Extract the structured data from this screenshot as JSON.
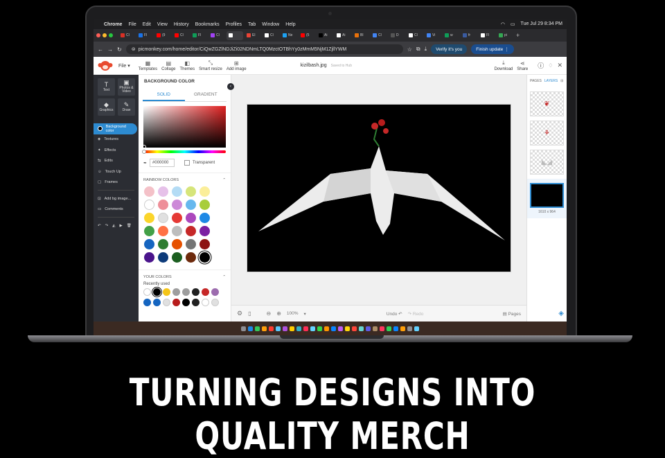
{
  "headline": "TURNING DESIGNS INTO QUALITY MERCH",
  "menubar": {
    "apple": "",
    "app": "Chrome",
    "items": [
      "File",
      "Edit",
      "View",
      "History",
      "Bookmarks",
      "Profiles",
      "Tab",
      "Window",
      "Help"
    ],
    "clock": "Tue Jul 29  8:34 PM"
  },
  "tabs": [
    "Cl",
    "Fl",
    "(9",
    "Cl",
    "Fl",
    "Cl",
    "",
    "El",
    "Cl",
    "Ne",
    "(5",
    "Ai",
    "Ai",
    "Bl",
    "Cl",
    "D",
    "Cl",
    "Vi",
    "w",
    "fr",
    "Fl",
    "pi"
  ],
  "addressbar": {
    "url": "picmonkey.com/home/editor/CiQwZGZlNDJiZi02NDNmLTQ0MzctOTBhYy0zMmM5NjM1ZjllYWM",
    "verify": "Verify it's you",
    "finish": "Finish update"
  },
  "header": {
    "file": "File",
    "tools": [
      "Templates",
      "Collage",
      "Themes",
      "Smart resize",
      "Add image"
    ],
    "filename": "kizilbash.jpg",
    "saved": "Saved to Hub",
    "download": "Download",
    "share": "Share"
  },
  "leftnav": {
    "big": [
      {
        "label": "Text",
        "icon": "T"
      },
      {
        "label": "Photos & Video",
        "icon": "▣"
      },
      {
        "label": "Graphics",
        "icon": "◆"
      },
      {
        "label": "Draw",
        "icon": "✎"
      }
    ],
    "items": [
      "Background color",
      "Textures",
      "Effects",
      "Edits",
      "Touch Up",
      "Frames",
      "Add bg image...",
      "Comments"
    ]
  },
  "panel": {
    "title": "BACKGROUND COLOR",
    "solid": "SOLID",
    "gradient": "GRADIENT",
    "hex": "#000000",
    "transparent": "Transparent",
    "rainbow": "RAINBOW COLORS",
    "your_colors": "YOUR COLORS",
    "recently_used": "Recently used",
    "rainbow_swatches": [
      "#f4c1c8",
      "#e6c1e9",
      "#b4dcf5",
      "#d6e57a",
      "#fbee9a",
      "#ffffff",
      "#ee8f99",
      "#cd8ad8",
      "#66b8ee",
      "#a8cd3a",
      "#fbd52b",
      "#e0e0e0",
      "#e53935",
      "#ab47bc",
      "#1e88e5",
      "#43a047",
      "#ff7043",
      "#bdbdbd",
      "#c62828",
      "#7b1fa2",
      "#1565c0",
      "#2e7d32",
      "#e65100",
      "#757575",
      "#8e1414",
      "#4a148c",
      "#0d3a7a",
      "#1b5e20",
      "#6d2a0c",
      "#000000"
    ],
    "recent_swatches": [
      "#ffffff",
      "#000000",
      "#f5c518",
      "#9e9e9e",
      "#9e9e9e",
      "#212121",
      "#c62828",
      "#9c6cae",
      "#1565c0",
      "#1565c0",
      "#e0e0e0",
      "#b71c1c",
      "#000000",
      "#212121",
      "#ffffff",
      "#e0e0e0"
    ]
  },
  "bottombar": {
    "zoom": "100%",
    "undo": "Undo",
    "redo": "Redo",
    "pages": "Pages"
  },
  "rightpanel": {
    "pages": "PAGES",
    "layers": "LAYERS",
    "size": "1610 x 964"
  }
}
